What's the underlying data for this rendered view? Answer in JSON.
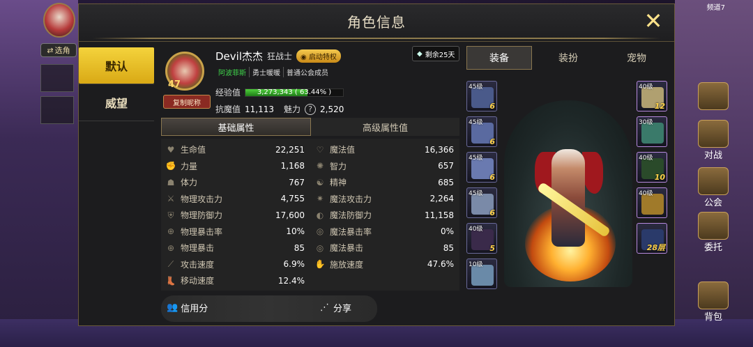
{
  "panel": {
    "title": "角色信息",
    "close_icon": "close-icon"
  },
  "nav": {
    "items": [
      {
        "label": "默认",
        "active": true
      },
      {
        "label": "威望",
        "active": false
      }
    ]
  },
  "profile": {
    "name": "Devil杰杰",
    "class": "狂战士",
    "privilege": "启动特权",
    "level": "47",
    "copy_nick": "复制昵称",
    "tags": [
      "阿波菲斯",
      "勇士暖暖",
      "普通公会成员"
    ],
    "exp_label": "经验值",
    "exp_value": "3,273,343 ( 63.44% )",
    "exp_percent": 0.6344,
    "resist_label": "抗魔值",
    "resist_value": "11,113",
    "charm_label": "魅力",
    "charm_value": "2,520",
    "remaining": "剩余25天"
  },
  "attr_tabs": [
    "基础属性",
    "高级属性值"
  ],
  "attributes": {
    "left": [
      {
        "label": "生命值",
        "value": "22,251",
        "icon": "heart-icon"
      },
      {
        "label": "力量",
        "value": "1,168",
        "icon": "arm-icon"
      },
      {
        "label": "体力",
        "value": "767",
        "icon": "body-icon"
      },
      {
        "label": "物理攻击力",
        "value": "4,755",
        "icon": "sword-icon"
      },
      {
        "label": "物理防御力",
        "value": "17,600",
        "icon": "shield-icon"
      },
      {
        "label": "物理暴击率",
        "value": "10%",
        "icon": "crosshair-icon"
      },
      {
        "label": "物理暴击",
        "value": "85",
        "icon": "crosshair-icon"
      },
      {
        "label": "攻击速度",
        "value": "6.9%",
        "icon": "speed-sword-icon"
      },
      {
        "label": "移动速度",
        "value": "12.4%",
        "icon": "boot-icon"
      }
    ],
    "right": [
      {
        "label": "魔法值",
        "value": "16,366",
        "icon": "heart-outline-icon"
      },
      {
        "label": "智力",
        "value": "657",
        "icon": "brain-icon"
      },
      {
        "label": "精神",
        "value": "685",
        "icon": "spirit-icon"
      },
      {
        "label": "魔法攻击力",
        "value": "2,264",
        "icon": "star-burst-icon"
      },
      {
        "label": "魔法防御力",
        "value": "11,158",
        "icon": "magic-shield-icon"
      },
      {
        "label": "魔法暴击率",
        "value": "0%",
        "icon": "target-icon"
      },
      {
        "label": "魔法暴击",
        "value": "85",
        "icon": "target-icon"
      },
      {
        "label": "施放速度",
        "value": "47.6%",
        "icon": "hand-icon"
      }
    ]
  },
  "bottom": {
    "credit": "信用分",
    "share": "分享"
  },
  "equip_tabs": [
    "装备",
    "装扮",
    "宠物"
  ],
  "slots_left": [
    {
      "level": "45级",
      "count": "6"
    },
    {
      "level": "45级",
      "count": "6"
    },
    {
      "level": "45级",
      "count": "6"
    },
    {
      "level": "45级",
      "count": "6"
    },
    {
      "level": "40级",
      "count": "5"
    },
    {
      "level": "10级",
      "count": ""
    }
  ],
  "slots_right": [
    {
      "level": "40级",
      "count": "12"
    },
    {
      "level": "30级",
      "count": ""
    },
    {
      "level": "40级",
      "count": "10"
    },
    {
      "level": "40级",
      "count": ""
    },
    {
      "level": "",
      "count": "28层"
    }
  ],
  "hud": {
    "select_role": "选角",
    "right_labels": [
      "对战",
      "公会",
      "委托",
      "背包"
    ],
    "channel": "频道7"
  }
}
